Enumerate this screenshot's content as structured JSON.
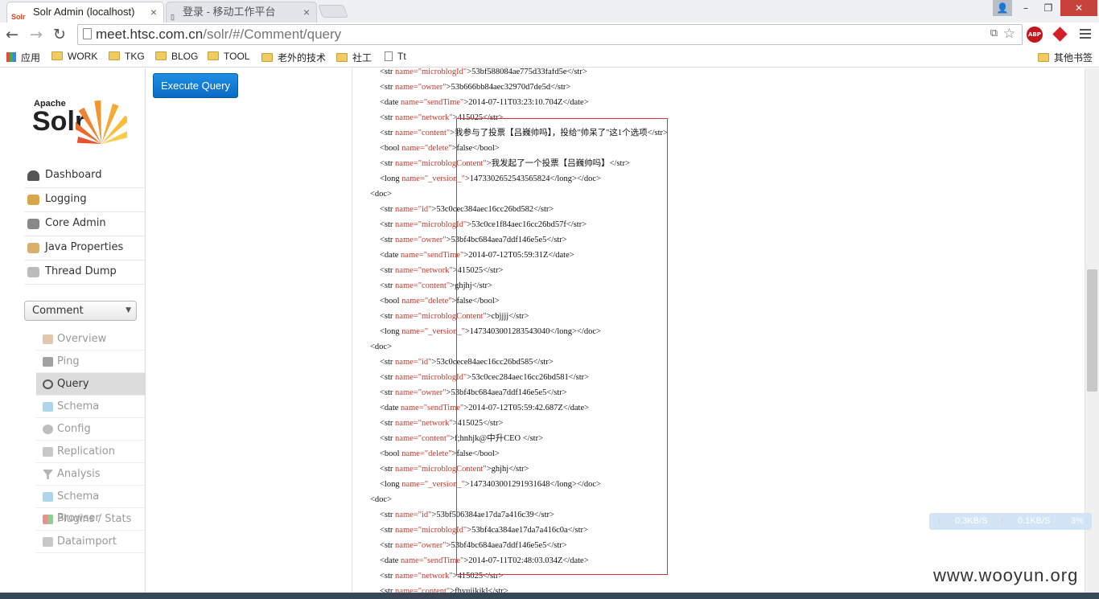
{
  "browser": {
    "tabs": [
      {
        "title": "Solr Admin (localhost)",
        "favicon": "solr",
        "active": true
      },
      {
        "title": "登录 - 移动工作平台",
        "favicon": "page",
        "active": false
      }
    ],
    "url_host": "meet.htsc.com.cn",
    "url_path": "/solr/#/Comment/query",
    "bookmarks": [
      "应用",
      "WORK",
      "TKG",
      "BLOG",
      "TOOL",
      "老外的技术",
      "社工",
      "Tt"
    ],
    "other_bookmarks": "其他书签",
    "abp_label": "ABP"
  },
  "solr": {
    "logo_top": "Apache",
    "logo_main": "Solr",
    "menu": [
      {
        "label": "Dashboard",
        "icon": "dashboard-icon"
      },
      {
        "label": "Logging",
        "icon": "logging-icon"
      },
      {
        "label": "Core Admin",
        "icon": "core-admin-icon"
      },
      {
        "label": "Java Properties",
        "icon": "java-properties-icon"
      },
      {
        "label": "Thread Dump",
        "icon": "thread-dump-icon"
      }
    ],
    "core_selected": "Comment",
    "core_menu": [
      {
        "label": "Overview",
        "icon": "overview-icon",
        "active": false
      },
      {
        "label": "Ping",
        "icon": "ping-icon",
        "active": false
      },
      {
        "label": "Query",
        "icon": "query-icon",
        "active": true
      },
      {
        "label": "Schema",
        "icon": "schema-icon",
        "active": false
      },
      {
        "label": "Config",
        "icon": "config-icon",
        "active": false
      },
      {
        "label": "Replication",
        "icon": "replication-icon",
        "active": false
      },
      {
        "label": "Analysis",
        "icon": "analysis-icon",
        "active": false
      },
      {
        "label": "Schema Browser",
        "icon": "schema-browser-icon",
        "active": false
      },
      {
        "label": "Plugins / Stats",
        "icon": "plugins-icon",
        "active": false
      },
      {
        "label": "Dataimport",
        "icon": "dataimport-icon",
        "active": false
      }
    ],
    "execute_label": "Execute Query"
  },
  "results": [
    {
      "indent": 1,
      "open": "<str",
      "name": "microblogId",
      "value": ">53bf588084ae775d33fafd5e</str>"
    },
    {
      "indent": 1,
      "open": "<str",
      "name": "owner",
      "value": ">53b666bb84aec32970d7de5d</str>"
    },
    {
      "indent": 1,
      "open": "<date",
      "name": "sendTime",
      "value": ">2014-07-11T03:23:10.704Z</date>"
    },
    {
      "indent": 1,
      "open": "<str",
      "name": "network",
      "value": ">415025</str>"
    },
    {
      "indent": 1,
      "open": "<str",
      "name": "content",
      "value": ">我参与了投票【吕巍帅吗】，投给\"帅呆了\"这1个选项</str>"
    },
    {
      "indent": 1,
      "open": "<bool",
      "name": "delete",
      "value": ">false</bool>"
    },
    {
      "indent": 1,
      "open": "<str",
      "name": "microblogContent",
      "value": ">我发起了一个投票【吕巍帅吗】</str>"
    },
    {
      "indent": 1,
      "open": "<long",
      "name": "_version_",
      "value": ">1473302652543565824</long></doc>"
    },
    {
      "indent": 0,
      "text": "<doc>"
    },
    {
      "indent": 1,
      "open": "<str",
      "name": "id",
      "value": ">53c0cec384aec16cc26bd582</str>"
    },
    {
      "indent": 1,
      "open": "<str",
      "name": "microblogId",
      "value": ">53c0ce1f84aec16cc26bd57f</str>"
    },
    {
      "indent": 1,
      "open": "<str",
      "name": "owner",
      "value": ">53bf4bc684aea7ddf146e5e5</str>"
    },
    {
      "indent": 1,
      "open": "<date",
      "name": "sendTime",
      "value": ">2014-07-12T05:59:31Z</date>"
    },
    {
      "indent": 1,
      "open": "<str",
      "name": "network",
      "value": ">415025</str>"
    },
    {
      "indent": 1,
      "open": "<str",
      "name": "content",
      "value": ">ghjhj</str>"
    },
    {
      "indent": 1,
      "open": "<bool",
      "name": "delete",
      "value": ">false</bool>"
    },
    {
      "indent": 1,
      "open": "<str",
      "name": "microblogContent",
      "value": ">cbjjjj</str>"
    },
    {
      "indent": 1,
      "open": "<long",
      "name": "_version_",
      "value": ">1473403001283543040</long></doc>"
    },
    {
      "indent": 0,
      "text": "<doc>"
    },
    {
      "indent": 1,
      "open": "<str",
      "name": "id",
      "value": ">53c0cece84aec16cc26bd585</str>"
    },
    {
      "indent": 1,
      "open": "<str",
      "name": "microblogId",
      "value": ">53c0cec284aec16cc26bd581</str>"
    },
    {
      "indent": 1,
      "open": "<str",
      "name": "owner",
      "value": ">53bf4bc684aea7ddf146e5e5</str>"
    },
    {
      "indent": 1,
      "open": "<date",
      "name": "sendTime",
      "value": ">2014-07-12T05:59:42.687Z</date>"
    },
    {
      "indent": 1,
      "open": "<str",
      "name": "network",
      "value": ">415025</str>"
    },
    {
      "indent": 1,
      "open": "<str",
      "name": "content",
      "value": ">f;hnhjk@中升CEO </str>"
    },
    {
      "indent": 1,
      "open": "<bool",
      "name": "delete",
      "value": ">false</bool>"
    },
    {
      "indent": 1,
      "open": "<str",
      "name": "microblogContent",
      "value": ">ghjhj</str>"
    },
    {
      "indent": 1,
      "open": "<long",
      "name": "_version_",
      "value": ">1473403001291931648</long></doc>"
    },
    {
      "indent": 0,
      "text": "<doc>"
    },
    {
      "indent": 1,
      "open": "<str",
      "name": "id",
      "value": ">53bf506384ae17da7a416c39</str>"
    },
    {
      "indent": 1,
      "open": "<str",
      "name": "microblogId",
      "value": ">53bf4ca384ae17da7a416c0a</str>"
    },
    {
      "indent": 1,
      "open": "<str",
      "name": "owner",
      "value": ">53bf4bc684aea7ddf146e5e5</str>"
    },
    {
      "indent": 1,
      "open": "<date",
      "name": "sendTime",
      "value": ">2014-07-11T02:48:03.034Z</date>"
    },
    {
      "indent": 1,
      "open": "<str",
      "name": "network",
      "value": ">415025</str>"
    },
    {
      "indent": 1,
      "open": "<str",
      "name": "content",
      "value": ">fhyujikjkl</str>"
    }
  ],
  "net_meter": {
    "down": "0.3KB/S",
    "up": "0.1KB/S",
    "cpu": "3%"
  },
  "watermark": "www.wooyun.org",
  "colors": {
    "attr": "#c0392b",
    "accent": "#0a6ac4",
    "highlight_box": "#e0313a"
  }
}
